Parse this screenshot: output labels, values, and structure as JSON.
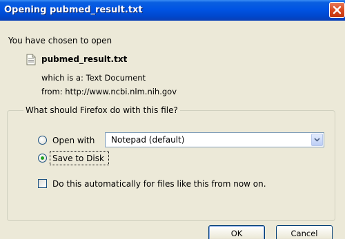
{
  "window": {
    "title": "Opening pubmed_result.txt",
    "close_icon": "close-icon"
  },
  "intro": "You have chosen to open",
  "file": {
    "name": "pubmed_result.txt",
    "icon": "text-file-icon",
    "type_line": "which is a: Text Document",
    "from_line": "from: http://www.ncbi.nlm.nih.gov"
  },
  "action_group": {
    "legend": "What should Firefox do with this file?",
    "open_with": {
      "label": "Open with",
      "app": "Notepad (default)",
      "selected": false
    },
    "save_to_disk": {
      "label": "Save to Disk",
      "selected": true
    },
    "auto": {
      "label": "Do this automatically for files like this from now on.",
      "checked": false
    }
  },
  "buttons": {
    "ok": "OK",
    "cancel": "Cancel"
  },
  "colors": {
    "titlebar": "#0054e3",
    "dialog_bg": "#ece9d8",
    "close_button": "#d9461b",
    "radio_dot": "#21a121"
  }
}
